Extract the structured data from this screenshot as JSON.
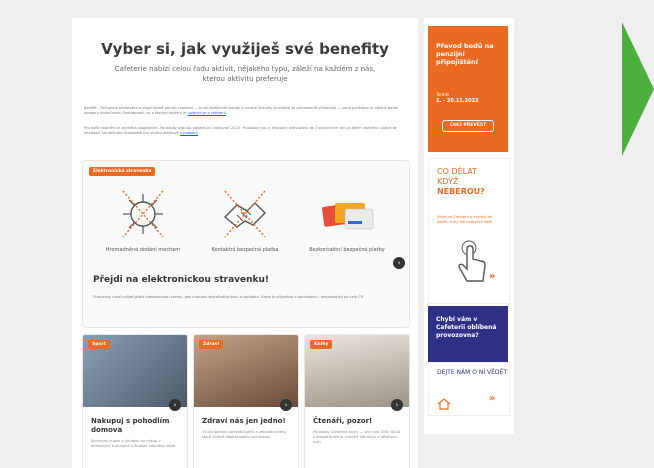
{
  "main": {
    "title": "Vyber si, jak využiješ své benefity",
    "subtitle": "Cafeterie nabízí celou řadu aktivit, nějakého typu, záleží na každém z nás, kterou aktivitu preferuje",
    "fine1": "Benefit ‑ Pečujeme především o stop-hlavně penzijní spoření — tu ze zkušenosti pouze u mnohé fortunty je možné jej přednostně přiřazovat — cena poukázky je přesná podle podpory skutečnosti: Podrobnosti, co a kterým tarifem je",
    "fine1_link": "uplatnit se v cafeterii",
    "fine2": "Pro další naplnění je zejména zpoplatněn. Poukázky platí do následující zúčtovací 2023. Poukázky jsou k dispozici aktivováno do 3 pracovních dní po jejich obdržení, pokud se nepodaří, kontaktujte hromadně pro službu jazykové",
    "fine2_link": "u podpory"
  },
  "promo": {
    "badge": "Elektronická stravenka",
    "features": [
      {
        "icon": "virus-icon",
        "caption": "Hromadněné dodání mechem"
      },
      {
        "icon": "handshake-icon",
        "caption": "Kontaktní bezpečná platba"
      },
      {
        "icon": "cards-icon",
        "caption": "Bezkontaktní bezpečné platby"
      }
    ],
    "heading": "Přejdi na elektronickou stravenku!",
    "desc": "Stravenky nově můžeš platit elektronickou kartou, bez nutnosti zbytečného tisku a kontaktu. Karta je přijímána v obchodech i restauracích po celé ČR."
  },
  "cards": [
    {
      "badge": "Sport",
      "title": "Nakupuj s pohodlím domova",
      "text": "Sportovní kupon s úhradou na nákup v oblíbených e-shopech s širokou nabídkou zboží"
    },
    {
      "badge": "Zdraví",
      "title": "Zdraví nás jen jedno!",
      "text": "Využij balíček zdravotní péče a zdravotnického zboží včetně lékárenského sortimentu"
    },
    {
      "badge": "Knihy",
      "title": "Čtenáři, pozor!",
      "text": "Poukázky Cafeterie Knihy — více než 3000 titulů z oblasti beletrie, naučné literatury a dětských knih"
    }
  ],
  "side": {
    "pension_title": "Převod bodů na penzijní připojištění",
    "pension_label": "Termín",
    "pension_date": "1. - 20.11.2022",
    "pension_btn": "CHCI PŘEVÉST",
    "neberou_1": "CO DĚLAT",
    "neberou_2": "KDYŽ",
    "neberou_3": "NEBEROU?",
    "neberou_sub": "Sdílej ve Cafeterii a nabídni do pátek, a my dál poskytne lepší",
    "missing_title": "Chybí vám v Cafeterii oblíbená provozovna?",
    "missing_cta": "DEJTE NÁM O NÍ VĚDĚT"
  },
  "colors": {
    "accent": "#ea6a22",
    "navy": "#2f3187",
    "green": "#4caf3e"
  }
}
